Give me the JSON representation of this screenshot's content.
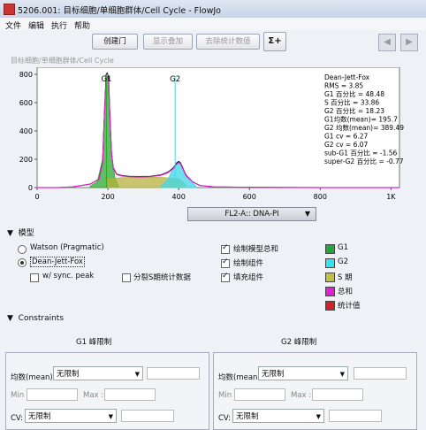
{
  "window": {
    "title": "5206.001: 目标细胞/单细胞群体/Cell Cycle - FlowJo",
    "menu": [
      "文件",
      "编辑",
      "执行",
      "帮助"
    ]
  },
  "toolbar": {
    "create_gate": "创建门",
    "show_overlay": "显示叠加",
    "remove_stats": "去除统计数值",
    "sigma": "Σ+"
  },
  "breadcrumb": "目标细胞/单细胞群体/Cell Cycle",
  "chart_data": {
    "type": "area",
    "title": "",
    "x_ticks": [
      "0",
      "200",
      "400",
      "600",
      "800",
      "1K"
    ],
    "y_ticks": [
      "0",
      "200",
      "400",
      "600",
      "800"
    ],
    "xlim": [
      0,
      1024
    ],
    "ylim": [
      0,
      850
    ],
    "gate_labels": [
      "G1",
      "G2"
    ],
    "markers": [
      {
        "label": "G1",
        "x": 196
      },
      {
        "label": "G2",
        "x": 390
      }
    ],
    "series": [
      {
        "x": [
          0,
          60,
          100,
          150,
          175,
          185,
          190,
          195,
          198,
          202,
          205,
          210,
          215,
          225,
          240,
          260,
          290,
          320,
          350,
          370,
          385,
          395,
          400,
          405,
          410,
          420,
          440,
          460,
          500,
          600,
          800,
          1024
        ],
        "values": [
          0,
          0,
          5,
          25,
          60,
          180,
          520,
          800,
          810,
          780,
          560,
          260,
          140,
          95,
          85,
          80,
          78,
          80,
          90,
          110,
          140,
          175,
          185,
          175,
          150,
          90,
          40,
          15,
          5,
          2,
          0,
          0
        ]
      }
    ],
    "components": [
      {
        "name": "G1",
        "values_x": [
          150,
          170,
          185,
          190,
          195,
          200,
          205,
          210,
          220,
          230
        ],
        "values_y": [
          10,
          40,
          200,
          500,
          790,
          780,
          540,
          240,
          70,
          10
        ]
      },
      {
        "name": "S 期",
        "values_x": [
          200,
          240,
          280,
          320,
          360,
          400,
          420
        ],
        "values_y": [
          60,
          70,
          72,
          74,
          70,
          60,
          20
        ]
      },
      {
        "name": "G2",
        "values_x": [
          350,
          370,
          385,
          395,
          400,
          405,
          415,
          430,
          450
        ],
        "values_y": [
          10,
          60,
          140,
          180,
          185,
          170,
          120,
          50,
          10
        ]
      }
    ],
    "stats": [
      "Dean-Jett-Fox",
      "RMS = 3.85",
      "G1 百分比 = 48.48",
      "S 百分比 = 33.86",
      "G2 百分比 = 18.23",
      "G1均数(mean)= 195.7",
      "G2 均数(mean)= 389.49",
      "G1 cv = 6.27",
      "G2 cv = 6.07",
      "sub-G1 百分比 = -1.56",
      "super-G2 百分比 = -0.77"
    ],
    "xaxis_param": "FL2-A:: DNA-PI",
    "colors": {
      "G1": "#2ea82e",
      "G2": "#3fd7e8",
      "S": "#b5b23d",
      "sum": "#d926c9",
      "stat": "#d3202a"
    }
  },
  "model": {
    "header": "模型",
    "options": [
      "Watson (Pragmatic)",
      "Dean-Jett-Fox"
    ],
    "sync_peak": "w/ sync. peak",
    "split_s": "分裂S期统计数据",
    "draw_sum": "绘制模型总和",
    "draw_comp": "绘制组件",
    "fill_comp": "填充组件"
  },
  "legend": [
    {
      "label": "G1",
      "color": "#22a83a"
    },
    {
      "label": "G2",
      "color": "#35e0ef"
    },
    {
      "label": "S 期",
      "color": "#c2c040"
    },
    {
      "label": "总和",
      "color": "#e020d6"
    },
    {
      "label": "统计值",
      "color": "#d3202a"
    }
  ],
  "constraints": {
    "header": "Constraints",
    "g1_title": "G1 峰限制",
    "g2_title": "G2 峰限制",
    "mean_label": "均数(mean):",
    "mean_value": "无限制",
    "min_label": "Min :",
    "max_label": "Max :",
    "cv_label": "CV:",
    "cv_value": "无限制"
  }
}
